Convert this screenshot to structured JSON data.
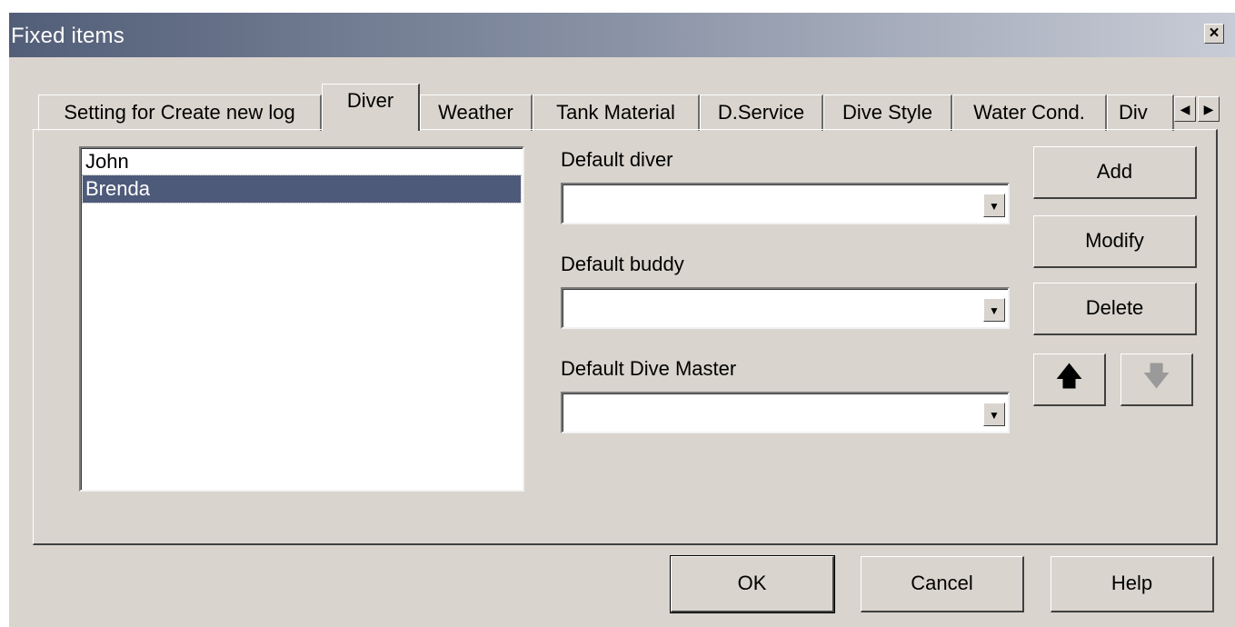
{
  "window": {
    "title": "Fixed items",
    "close_label": "×"
  },
  "tabs": [
    {
      "label": "Setting for Create new log"
    },
    {
      "label": "Diver",
      "active": true
    },
    {
      "label": "Weather"
    },
    {
      "label": "Tank Material"
    },
    {
      "label": "D.Service"
    },
    {
      "label": "Dive Style"
    },
    {
      "label": "Water Cond."
    },
    {
      "label": "Div"
    }
  ],
  "tab_scroll": {
    "left": "◀",
    "right": "▶"
  },
  "divers": {
    "items": [
      "John",
      "Brenda"
    ],
    "selected": "Brenda"
  },
  "fields": {
    "default_diver": {
      "label": "Default diver",
      "value": ""
    },
    "default_buddy": {
      "label": "Default buddy",
      "value": ""
    },
    "default_dive_master": {
      "label": "Default Dive Master",
      "value": ""
    },
    "dropdown_icon": "▼"
  },
  "side_buttons": {
    "add": "Add",
    "modify": "Modify",
    "delete": "Delete",
    "move_up_icon": "arrow-up-icon",
    "move_down_icon": "arrow-down-icon",
    "move_up_glyph": "🡅",
    "move_down_glyph": "🡇"
  },
  "footer": {
    "ok": "OK",
    "cancel": "Cancel",
    "help": "Help"
  }
}
